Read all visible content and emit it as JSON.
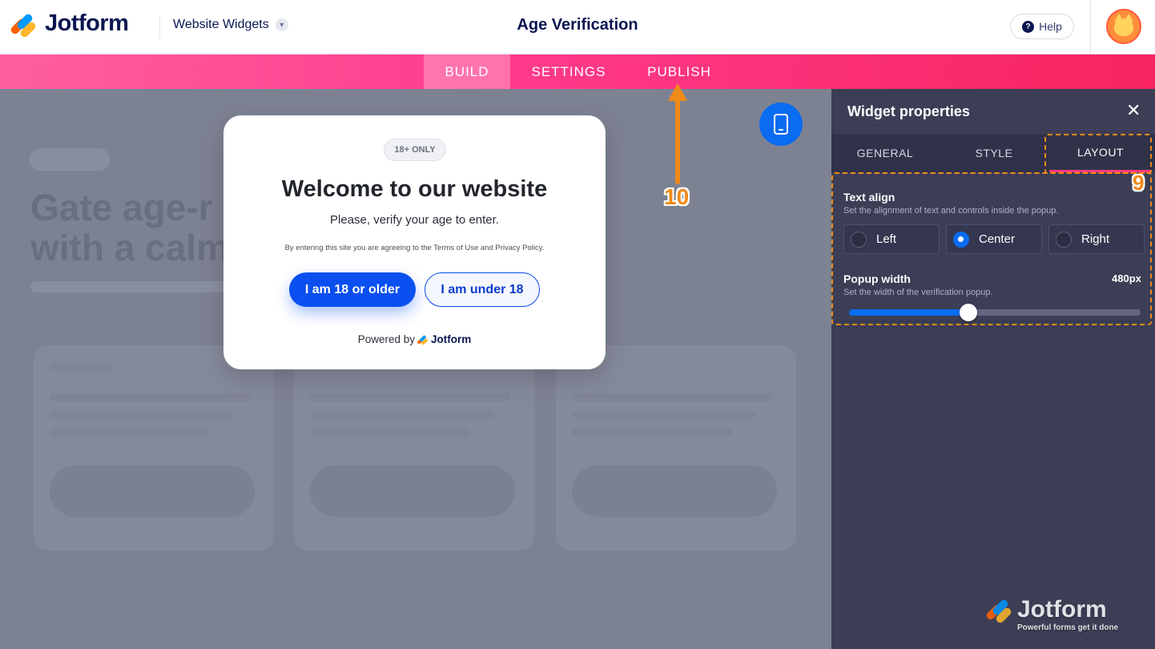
{
  "header": {
    "brand": "Jotform",
    "breadcrumb": "Website Widgets",
    "page_title": "Age Verification",
    "help_label": "Help"
  },
  "nav": {
    "tabs": [
      {
        "label": "BUILD",
        "active": true
      },
      {
        "label": "SETTINGS",
        "active": false
      },
      {
        "label": "PUBLISH",
        "active": false
      }
    ]
  },
  "preview": {
    "background_heading": [
      "Gate age-r",
      "with a calm"
    ],
    "popup": {
      "badge": "18+ ONLY",
      "title": "Welcome to our website",
      "subtitle": "Please, verify your age to enter.",
      "terms": "By entering this site you are agreeing to the Terms of Use and Privacy Policy.",
      "confirm_button": "I am 18 or older",
      "deny_button": "I am under 18",
      "powered_prefix": "Powered by",
      "powered_brand": "Jotform"
    }
  },
  "annotations": {
    "step_publish": "10",
    "step_layout": "9",
    "color": "#f08a18"
  },
  "panel": {
    "title": "Widget properties",
    "tabs": [
      {
        "label": "GENERAL",
        "active": false
      },
      {
        "label": "STYLE",
        "active": false
      },
      {
        "label": "LAYOUT",
        "active": true
      }
    ],
    "text_align": {
      "label": "Text align",
      "description": "Set the alignment of text and controls inside the popup.",
      "options": [
        {
          "label": "Left",
          "selected": false
        },
        {
          "label": "Center",
          "selected": true
        },
        {
          "label": "Right",
          "selected": false
        }
      ]
    },
    "popup_width": {
      "label": "Popup width",
      "description": "Set the width of the verification popup.",
      "value_text": "480px",
      "slider_fraction": 0.41
    },
    "watermark": {
      "brand": "Jotform",
      "tagline": "Powerful forms get it done"
    }
  },
  "colors": {
    "brand_navy": "#0a1551",
    "nav_pink": "#ff3a8b",
    "primary_blue": "#0a4ff0",
    "panel_bg": "#3b3e55"
  }
}
